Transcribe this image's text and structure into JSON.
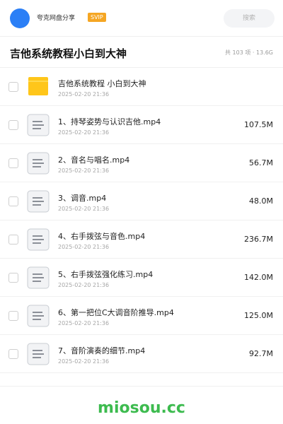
{
  "header": {
    "share_name": "夸克网盘分享",
    "badge": "SVIP",
    "search_label": "搜索"
  },
  "folder": {
    "title": "吉他系统教程小白到大神",
    "meta": "共 103 项 · 13.6G"
  },
  "items": [
    {
      "type": "folder",
      "icon": "folder-icon",
      "name": "吉他系统教程 小白到大神",
      "date": "2025-02-20 21:36",
      "size": ""
    },
    {
      "type": "file",
      "icon": "file-icon",
      "name": "1、持琴姿势与认识吉他.mp4",
      "date": "2025-02-20 21:36",
      "size": "107.5M"
    },
    {
      "type": "file",
      "icon": "file-icon",
      "name": "2、音名与唱名.mp4",
      "date": "2025-02-20 21:36",
      "size": "56.7M"
    },
    {
      "type": "file",
      "icon": "file-icon",
      "name": "3、调音.mp4",
      "date": "2025-02-20 21:36",
      "size": "48.0M"
    },
    {
      "type": "file",
      "icon": "file-icon",
      "name": "4、右手拨弦与音色.mp4",
      "date": "2025-02-20 21:36",
      "size": "236.7M"
    },
    {
      "type": "file",
      "icon": "file-icon",
      "name": "5、右手拨弦强化练习.mp4",
      "date": "2025-02-20 21:36",
      "size": "142.0M"
    },
    {
      "type": "file",
      "icon": "file-icon",
      "name": "6、第一把位C大调音阶推导.mp4",
      "date": "2025-02-20 21:36",
      "size": "125.0M"
    },
    {
      "type": "file",
      "icon": "file-icon",
      "name": "7、音阶演奏的细节.mp4",
      "date": "2025-02-20 21:36",
      "size": "92.7M"
    }
  ],
  "footer": {
    "watermark": "miosou.cc"
  },
  "colors": {
    "avatar": "#2b7ff6",
    "badge": "#f5a623",
    "folder": "#ffc61a",
    "watermark": "#3dbb4f"
  }
}
